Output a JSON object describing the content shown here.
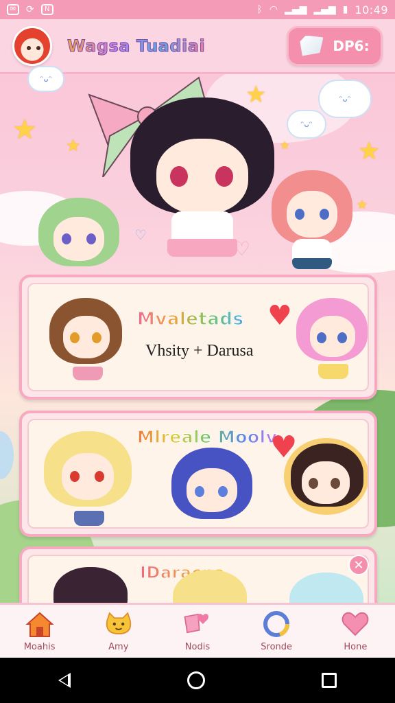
{
  "status_bar": {
    "left_icons": [
      "message-icon",
      "sync-icon",
      "notification-n-icon"
    ],
    "right_icons": [
      "bluetooth-icon",
      "wifi-icon",
      "signal-icon",
      "signal-icon-2",
      "battery-icon"
    ],
    "time": "10:49"
  },
  "header": {
    "app_title": "Wagsa Tuadiai",
    "gem_label": "DP6:"
  },
  "cards": [
    {
      "title": "Mvaletads",
      "subtitle": "Vhsity + Darusa"
    },
    {
      "title": "Mlreale Moolv"
    },
    {
      "title": "IDaracna"
    }
  ],
  "bottom_nav": [
    {
      "label": "Moahis",
      "icon": "home-icon"
    },
    {
      "label": "Amy",
      "icon": "cat-face-icon"
    },
    {
      "label": "Nodis",
      "icon": "hearts-icon"
    },
    {
      "label": "Sronde",
      "icon": "ring-icon"
    },
    {
      "label": "Hone",
      "icon": "chat-heart-icon"
    }
  ],
  "colors": {
    "primary_pink": "#f58fae",
    "header_bg": "#fbd6e2",
    "card_border": "#f6a9c0",
    "status_bar": "#f49bb8"
  }
}
